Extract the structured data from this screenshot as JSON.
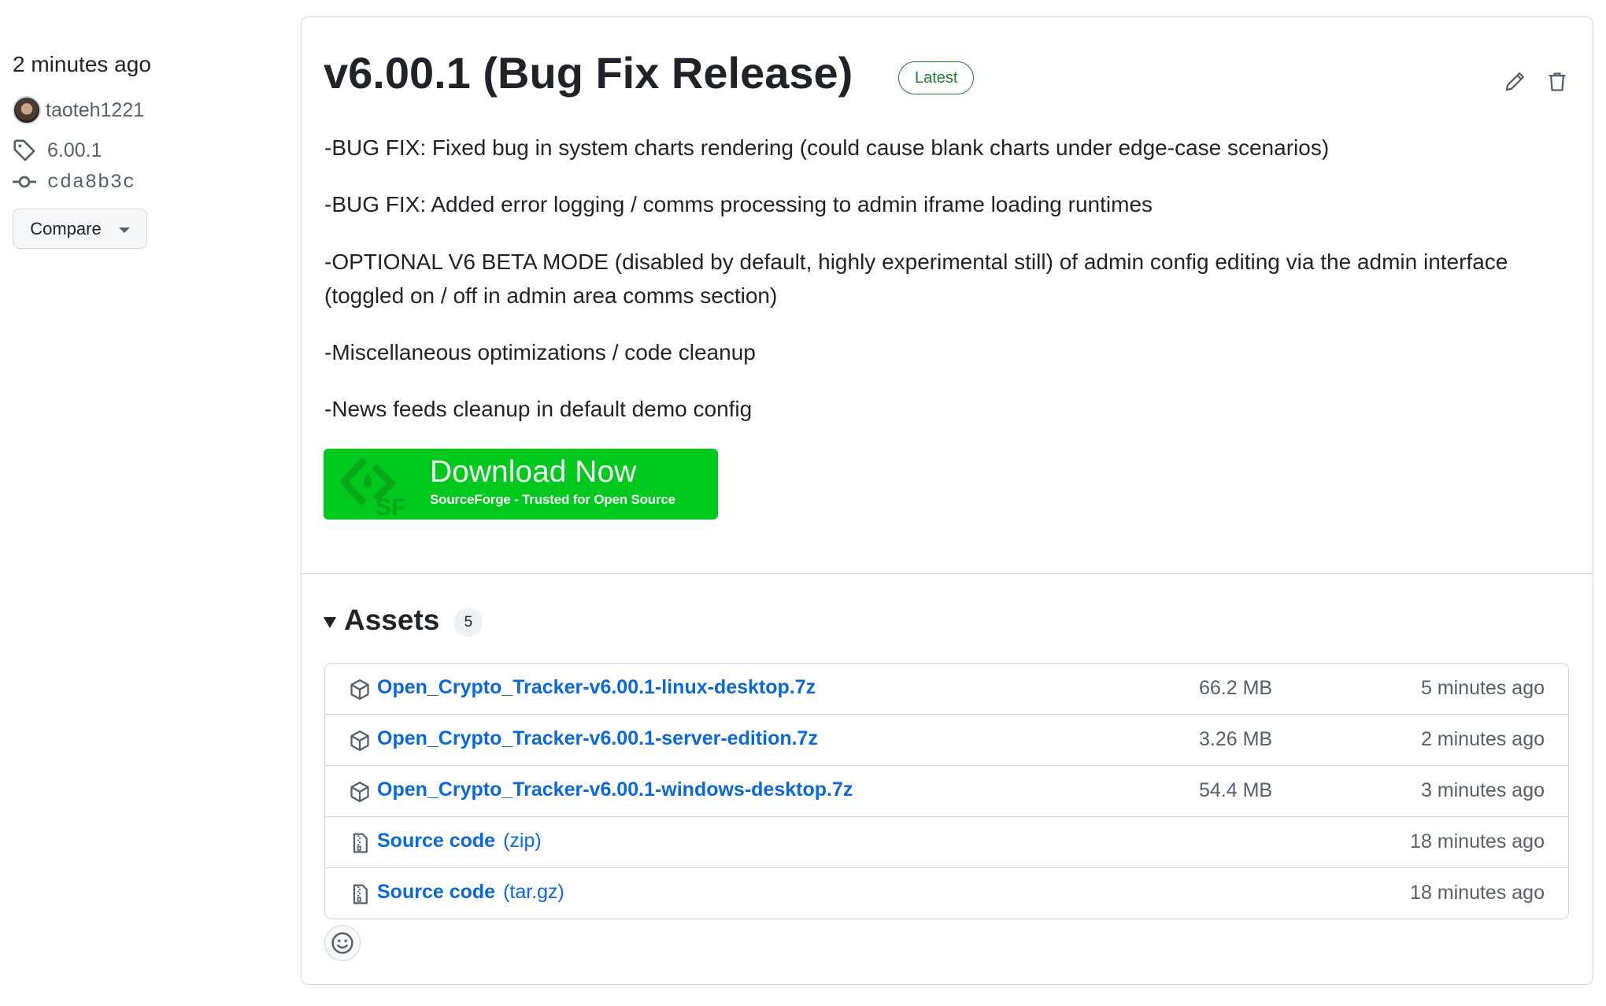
{
  "meta": {
    "relative_time": "2 minutes ago",
    "author": "taoteh1221",
    "tag": "6.00.1",
    "commit": "cda8b3c",
    "compare_label": "Compare"
  },
  "release": {
    "title": "v6.00.1 (Bug Fix Release)",
    "badge": "Latest",
    "notes": [
      "-BUG FIX: Fixed bug in system charts rendering (could cause blank charts under edge-case scenarios)",
      "-BUG FIX: Added error logging / comms processing to admin iframe loading runtimes",
      "-OPTIONAL V6 BETA MODE (disabled by default, highly experimental still) of admin config editing via the admin interface (toggled on / off in admin area comms section)",
      "-Miscellaneous optimizations / code cleanup",
      "-News feeds cleanup in default demo config"
    ],
    "download_button": {
      "title": "Download Now",
      "subtitle": "SourceForge - Trusted for Open Source",
      "color": "#00c91d"
    }
  },
  "assets": {
    "title": "Assets",
    "count": "5",
    "items": [
      {
        "name": "Open_Crypto_Tracker-v6.00.1-linux-desktop.7z",
        "ext": "",
        "size": "66.2 MB",
        "time": "5 minutes ago",
        "icon": "package-icon"
      },
      {
        "name": "Open_Crypto_Tracker-v6.00.1-server-edition.7z",
        "ext": "",
        "size": "3.26 MB",
        "time": "2 minutes ago",
        "icon": "package-icon"
      },
      {
        "name": "Open_Crypto_Tracker-v6.00.1-windows-desktop.7z",
        "ext": "",
        "size": "54.4 MB",
        "time": "3 minutes ago",
        "icon": "package-icon"
      },
      {
        "name": "Source code",
        "ext": "(zip)",
        "size": "",
        "time": "18 minutes ago",
        "icon": "file-zip-icon"
      },
      {
        "name": "Source code",
        "ext": "(tar.gz)",
        "size": "",
        "time": "18 minutes ago",
        "icon": "file-zip-icon"
      }
    ]
  },
  "colors": {
    "link": "#0969da",
    "muted": "#57606a",
    "success": "#1a7f37",
    "border": "#d0d7de"
  }
}
